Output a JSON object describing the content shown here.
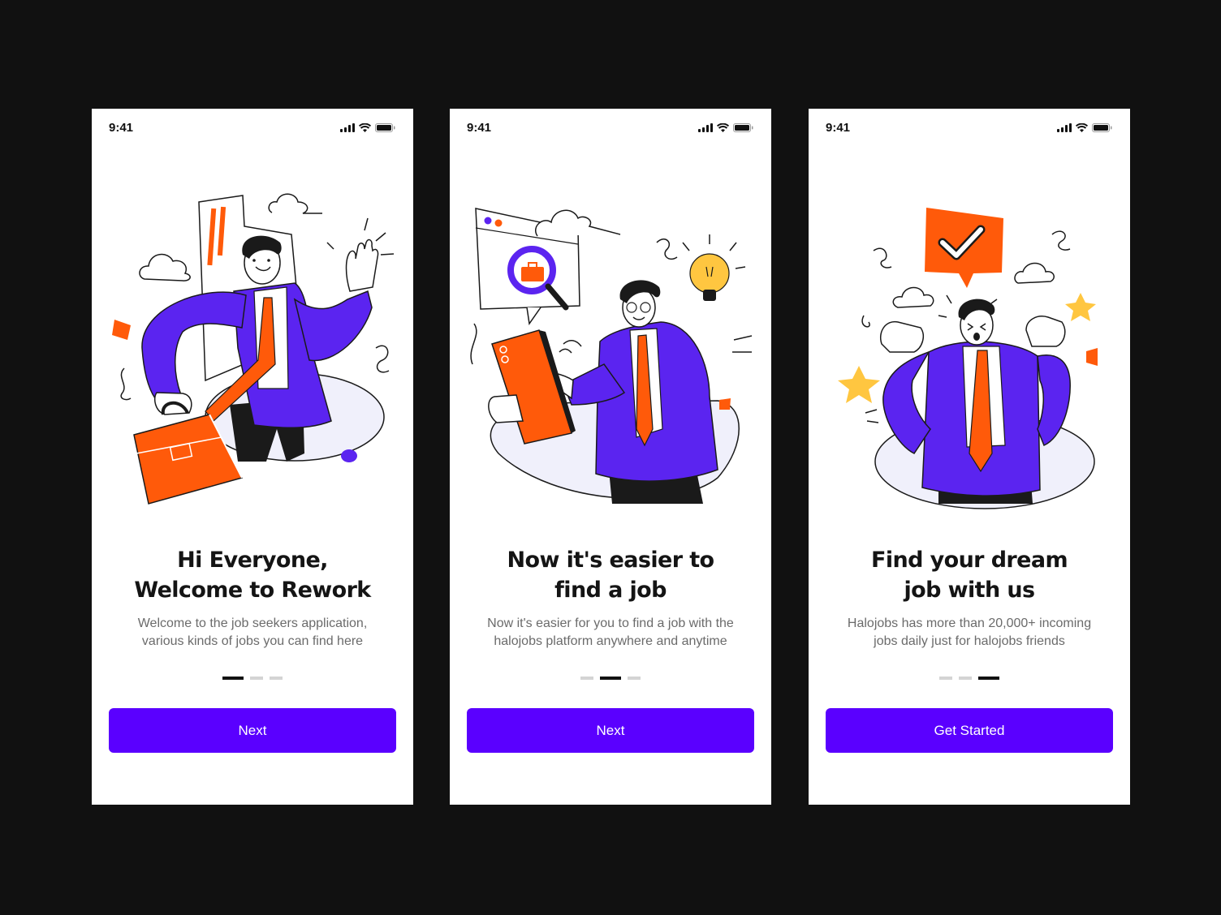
{
  "colors": {
    "background": "#111111",
    "screen": "#ffffff",
    "accent_purple": "#5a00ff",
    "illustration_purple": "#5b24f0",
    "illustration_orange": "#ff5a0a",
    "illustration_yellow": "#ffc640",
    "text_dark": "#141414",
    "text_muted": "#6b6b6b"
  },
  "screens": [
    {
      "status_time": "9:41",
      "illustration": "man-with-briefcase-waving",
      "title_lines": [
        "Hi Everyone,",
        "Welcome to Rework"
      ],
      "description_lines": [
        "Welcome to the job seekers application,",
        "various kinds of jobs you can find here"
      ],
      "active_page": 1,
      "page_count": 3,
      "button_label": "Next"
    },
    {
      "status_time": "9:41",
      "illustration": "man-searching-on-tablet",
      "title_lines": [
        "Now it's easier to",
        "find a job"
      ],
      "description_lines": [
        "Now it's easier for you to find a job with the",
        "halojobs platform anywhere and anytime"
      ],
      "active_page": 2,
      "page_count": 3,
      "button_label": "Next"
    },
    {
      "status_time": "9:41",
      "illustration": "man-celebrating-with-checkmark",
      "title_lines": [
        "Find your dream",
        "job with us"
      ],
      "description_lines": [
        "Halojobs has more than 20,000+ incoming",
        "jobs daily just for halojobs friends"
      ],
      "active_page": 3,
      "page_count": 3,
      "button_label": "Get Started"
    }
  ]
}
